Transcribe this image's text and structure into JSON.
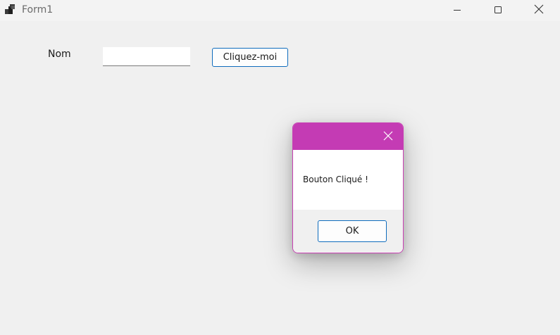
{
  "window": {
    "title": "Form1",
    "icons": {
      "app": "app-icon",
      "minimize": "minimize-icon",
      "maximize": "maximize-icon",
      "close": "close-icon"
    }
  },
  "form": {
    "name_label": "Nom",
    "name_input_value": "",
    "click_button_label": "Cliquez-moi"
  },
  "message_box": {
    "message": "Bouton Cliqué !",
    "ok_label": "OK",
    "close_icon": "close-icon"
  },
  "colors": {
    "accent_border": "#c83fb3",
    "dialog_titlebar": "#c43bb4",
    "button_border": "#0f6cbd",
    "background": "#f0f0f0"
  }
}
